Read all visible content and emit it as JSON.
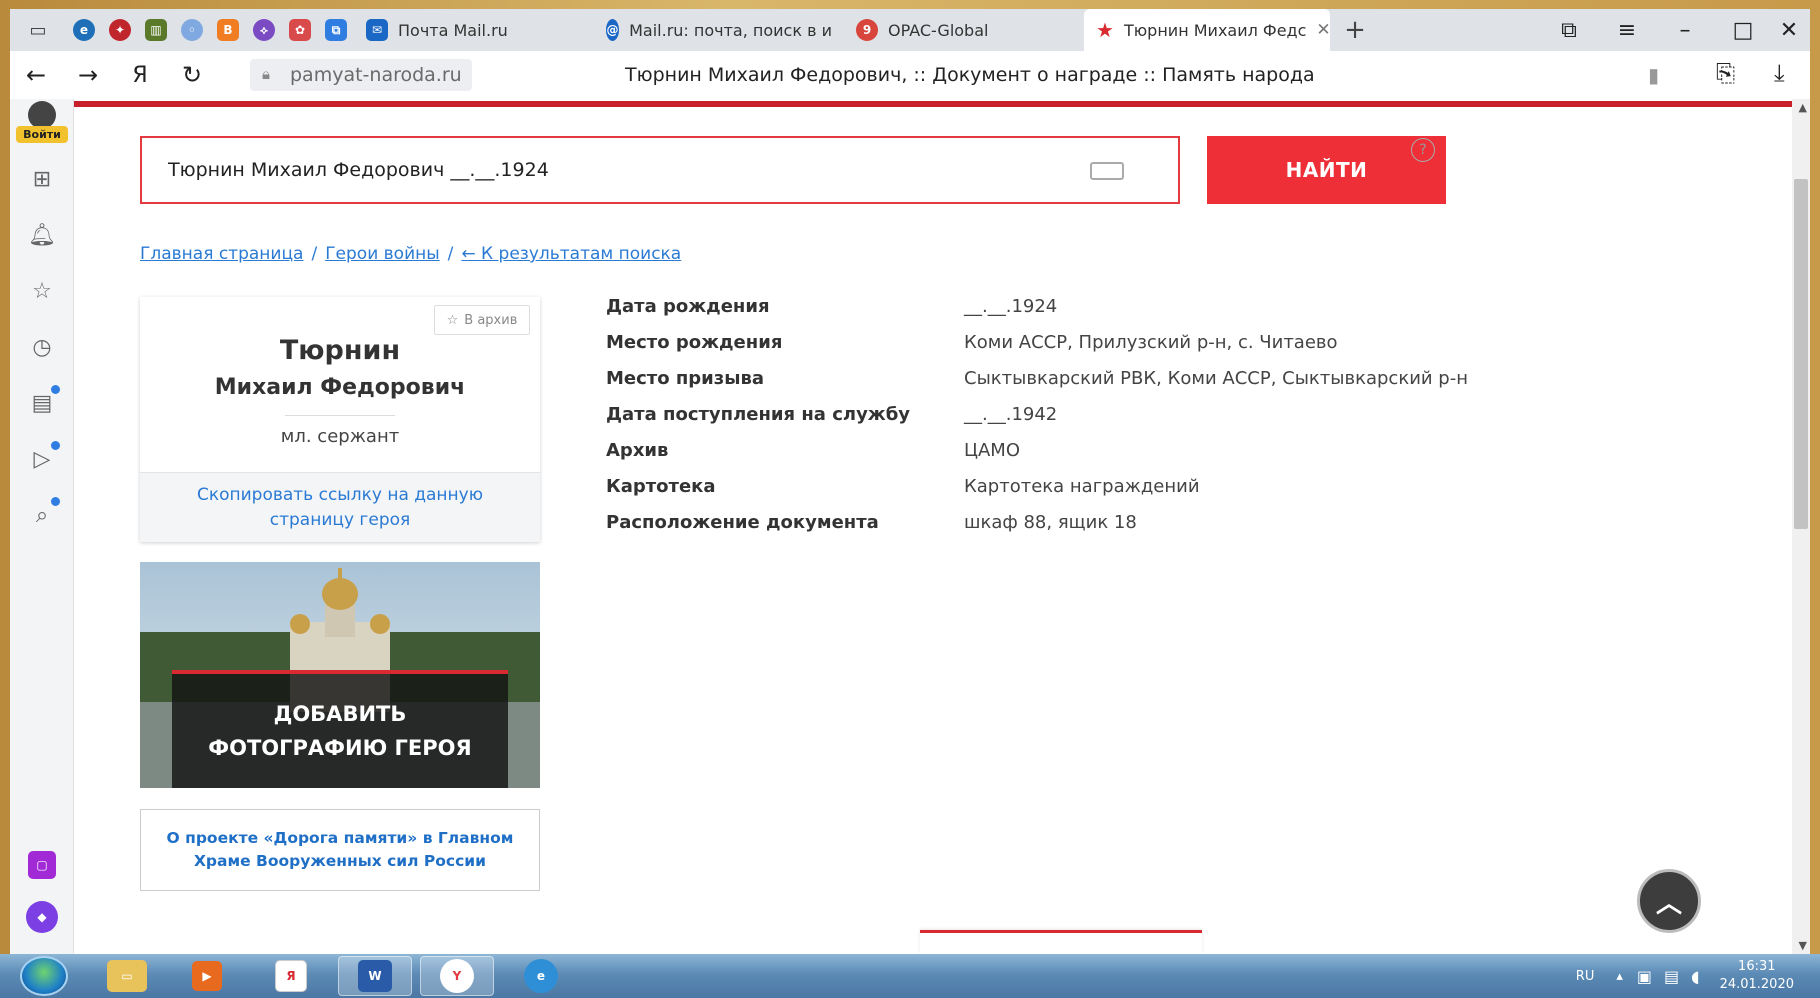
{
  "browser": {
    "tabs": [
      {
        "label": "Почта Mail.ru",
        "icon": "mail-icon",
        "active": false
      },
      {
        "label": "Mail.ru: почта, поиск в и",
        "icon": "mailru-icon",
        "active": false
      },
      {
        "label": "OPAC-Global",
        "icon": "opac-icon",
        "active": false
      },
      {
        "label": "Тюрнин Михаил Федс",
        "icon": "star-icon",
        "active": true
      }
    ],
    "new_tab": "+",
    "url_host": "pamyat-naroda.ru",
    "page_title": "Тюрнин Михаил Федорович, :: Документ о награде :: Память народа",
    "yandex_letter": "Я",
    "login_label": "Войти"
  },
  "search": {
    "query": "Тюрнин Михаил Федорович __.__.1924",
    "button_label": "НАЙТИ",
    "help": "?"
  },
  "breadcrumb": {
    "home": "Главная страница",
    "heroes": "Герои войны",
    "back": "← К результатам поиска",
    "sep": "/"
  },
  "hero": {
    "archive_label": "В архив",
    "surname": "Тюрнин",
    "given_names": "Михаил Федорович",
    "rank": "мл. сержант",
    "copy_link": "Скопировать ссылку на данную страницу героя",
    "add_photo": "ДОБАВИТЬ ФОТОГРАФИЮ ГЕРОЯ",
    "about_project": "О проекте «Дорога памяти» в Главном Храме Вооруженных сил России"
  },
  "details": [
    {
      "label": "Дата рождения",
      "value": "__.__.1924"
    },
    {
      "label": "Место рождения",
      "value": "Коми АССР, Прилузский р-н, с. Читаево"
    },
    {
      "label": "Место призыва",
      "value": "Сыктывкарский РВК, Коми АССР, Сыктывкарский р-н"
    },
    {
      "label": "Дата поступления на службу",
      "value": "__.__.1942"
    },
    {
      "label": "Архив",
      "value": "ЦАМО"
    },
    {
      "label": "Картотека",
      "value": "Картотека награждений"
    },
    {
      "label": "Расположение документа",
      "value": "шкаф 88, ящик 18"
    }
  ],
  "taskbar": {
    "lang": "RU",
    "time": "16:31",
    "date": "24.01.2020"
  },
  "colors": {
    "accent_red": "#ee2f37",
    "link_blue": "#2a7ad4"
  }
}
